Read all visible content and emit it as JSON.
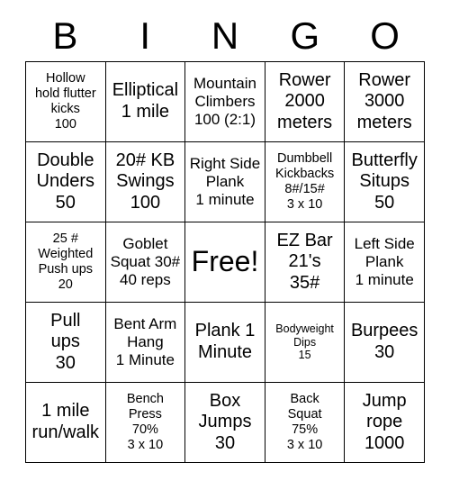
{
  "header": {
    "letters": [
      "B",
      "I",
      "N",
      "G",
      "O"
    ]
  },
  "grid": {
    "rows": 5,
    "columns": 5,
    "border_color": "#000000",
    "background_color": "#ffffff",
    "cells": [
      {
        "text": "Hollow\nhold flutter\nkicks\n100",
        "size": "sm"
      },
      {
        "text": "Elliptical\n1 mile",
        "size": "lg"
      },
      {
        "text": "Mountain\nClimbers\n100 (2:1)",
        "size": "md"
      },
      {
        "text": "Rower\n2000\nmeters",
        "size": "lg"
      },
      {
        "text": "Rower\n3000\nmeters",
        "size": "lg"
      },
      {
        "text": "Double\nUnders\n50",
        "size": "lg"
      },
      {
        "text": "20# KB\nSwings\n100",
        "size": "lg"
      },
      {
        "text": "Right Side\nPlank\n1 minute",
        "size": "md"
      },
      {
        "text": "Dumbbell\nKickbacks\n8#/15#\n3 x 10",
        "size": "sm"
      },
      {
        "text": "Butterfly\nSitups\n50",
        "size": "lg"
      },
      {
        "text": "25 #\nWeighted\nPush ups\n20",
        "size": "sm"
      },
      {
        "text": "Goblet\nSquat 30#\n40 reps",
        "size": "md"
      },
      {
        "text": "Free!",
        "size": "xl"
      },
      {
        "text": "EZ Bar\n21's\n35#",
        "size": "lg"
      },
      {
        "text": "Left Side\nPlank\n1 minute",
        "size": "md"
      },
      {
        "text": "Pull\nups\n30",
        "size": "lg"
      },
      {
        "text": "Bent Arm\nHang\n1 Minute",
        "size": "md"
      },
      {
        "text": "Plank 1\nMinute",
        "size": "lg"
      },
      {
        "text": "Bodyweight\nDips\n15",
        "size": "xs"
      },
      {
        "text": "Burpees\n30",
        "size": "lg"
      },
      {
        "text": "1 mile\nrun/walk",
        "size": "lg"
      },
      {
        "text": "Bench\nPress\n70%\n3 x 10",
        "size": "sm"
      },
      {
        "text": "Box\nJumps\n30",
        "size": "lg"
      },
      {
        "text": "Back\nSquat\n75%\n3 x 10",
        "size": "sm"
      },
      {
        "text": "Jump\nrope\n1000",
        "size": "lg"
      }
    ]
  }
}
